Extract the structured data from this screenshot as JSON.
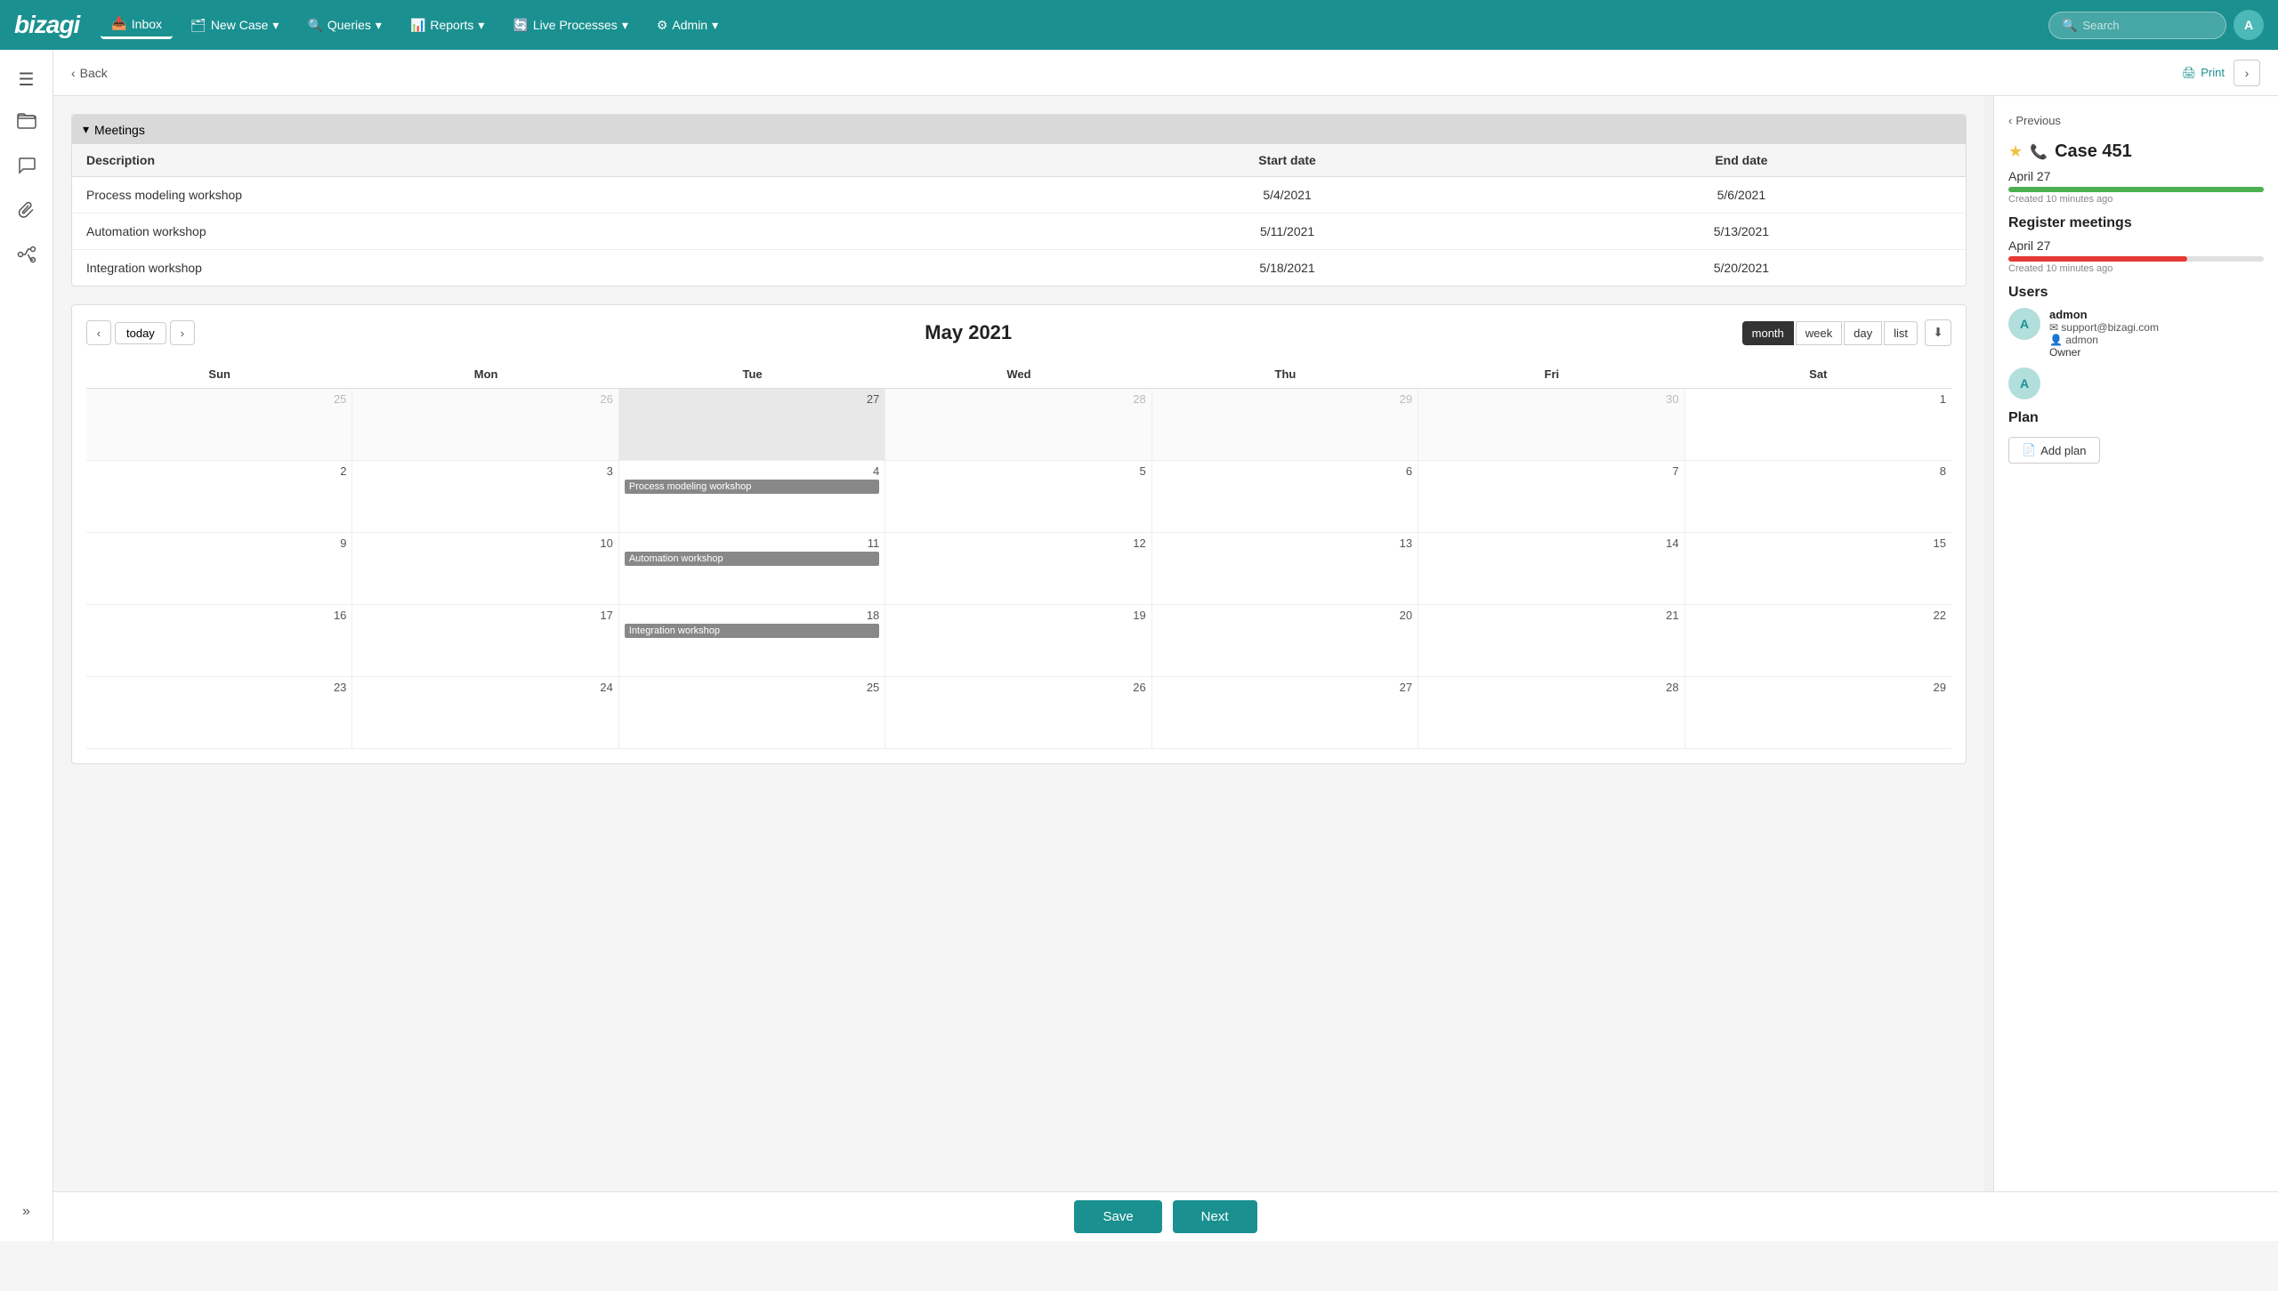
{
  "app": {
    "logo": "bizagi"
  },
  "topnav": {
    "inbox_label": "Inbox",
    "new_case_label": "New Case",
    "queries_label": "Queries",
    "reports_label": "Reports",
    "live_processes_label": "Live Processes",
    "admin_label": "Admin",
    "search_placeholder": "Search",
    "avatar_letter": "A"
  },
  "sub_header": {
    "back_label": "Back",
    "print_label": "Print"
  },
  "meetings": {
    "section_title": "Meetings",
    "col_description": "Description",
    "col_start_date": "Start date",
    "col_end_date": "End date",
    "rows": [
      {
        "description": "Process modeling workshop",
        "start_date": "5/4/2021",
        "end_date": "5/6/2021"
      },
      {
        "description": "Automation workshop",
        "start_date": "5/11/2021",
        "end_date": "5/13/2021"
      },
      {
        "description": "Integration workshop",
        "start_date": "5/18/2021",
        "end_date": "5/20/2021"
      }
    ]
  },
  "calendar": {
    "today_label": "today",
    "title": "May 2021",
    "views": [
      "month",
      "week",
      "day",
      "list"
    ],
    "active_view": "month",
    "day_names": [
      "Sun",
      "Mon",
      "Tue",
      "Wed",
      "Thu",
      "Fri",
      "Sat"
    ],
    "weeks": [
      {
        "days": [
          {
            "date": "25",
            "other_month": true,
            "events": []
          },
          {
            "date": "26",
            "other_month": true,
            "events": []
          },
          {
            "date": "27",
            "other_month": false,
            "highlighted": true,
            "events": []
          },
          {
            "date": "28",
            "other_month": true,
            "events": []
          },
          {
            "date": "29",
            "other_month": true,
            "events": []
          },
          {
            "date": "30",
            "other_month": true,
            "events": []
          },
          {
            "date": "1",
            "other_month": false,
            "events": []
          }
        ]
      },
      {
        "days": [
          {
            "date": "2",
            "events": []
          },
          {
            "date": "3",
            "events": []
          },
          {
            "date": "4",
            "events": [
              "Process modeling workshop"
            ]
          },
          {
            "date": "5",
            "events": []
          },
          {
            "date": "6",
            "events": []
          },
          {
            "date": "7",
            "events": []
          },
          {
            "date": "8",
            "events": []
          }
        ]
      },
      {
        "days": [
          {
            "date": "9",
            "events": []
          },
          {
            "date": "10",
            "events": []
          },
          {
            "date": "11",
            "events": [
              "Automation workshop"
            ]
          },
          {
            "date": "12",
            "events": []
          },
          {
            "date": "13",
            "events": []
          },
          {
            "date": "14",
            "events": []
          },
          {
            "date": "15",
            "events": []
          }
        ]
      },
      {
        "days": [
          {
            "date": "16",
            "events": []
          },
          {
            "date": "17",
            "events": []
          },
          {
            "date": "18",
            "events": [
              "Integration workshop"
            ]
          },
          {
            "date": "19",
            "events": []
          },
          {
            "date": "20",
            "events": []
          },
          {
            "date": "21",
            "events": []
          },
          {
            "date": "22",
            "events": []
          }
        ]
      },
      {
        "days": [
          {
            "date": "23",
            "events": []
          },
          {
            "date": "24",
            "events": []
          },
          {
            "date": "25",
            "events": []
          },
          {
            "date": "26",
            "events": []
          },
          {
            "date": "27",
            "events": []
          },
          {
            "date": "28",
            "events": []
          },
          {
            "date": "29",
            "events": []
          }
        ]
      }
    ]
  },
  "footer": {
    "save_label": "Save",
    "next_label": "Next"
  },
  "right_panel": {
    "previous_label": "Previous",
    "case_title": "Case 451",
    "date1": "April 27",
    "created1": "Created 10 minutes ago",
    "section_register": "Register meetings",
    "date2": "April 27",
    "created2": "Created 10 minutes ago",
    "users_title": "Users",
    "users": [
      {
        "avatar_letter": "A",
        "name": "admon",
        "email": "support@bizagi.com",
        "username": "admon",
        "role": "Owner"
      },
      {
        "avatar_letter": "A",
        "name": "",
        "email": "",
        "username": "",
        "role": ""
      }
    ],
    "plan_title": "Plan",
    "add_plan_label": "Add plan"
  },
  "sidebar": {
    "icons": [
      {
        "name": "inbox-icon",
        "symbol": "☰"
      },
      {
        "name": "folder-icon",
        "symbol": "📁"
      },
      {
        "name": "chat-icon",
        "symbol": "💬"
      },
      {
        "name": "attachment-icon",
        "symbol": "📎"
      },
      {
        "name": "workflow-icon",
        "symbol": "⎇"
      }
    ],
    "expand_label": "»"
  }
}
